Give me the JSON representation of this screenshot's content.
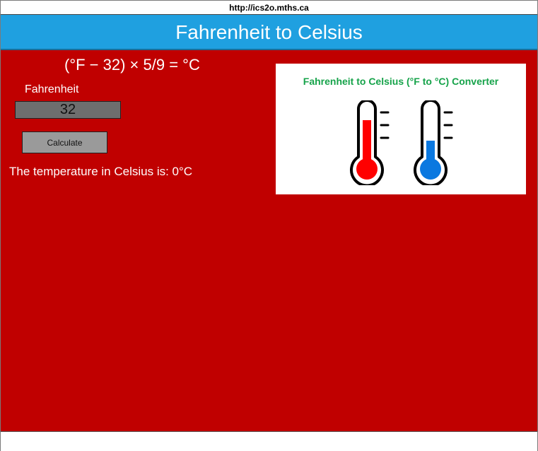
{
  "browser": {
    "url": "http://ics2o.mths.ca"
  },
  "header": {
    "title": "Fahrenheit to Celsius"
  },
  "main": {
    "formula": "(°F − 32) × 5/9 = °C",
    "input_label": "Fahrenheit",
    "input_value": "32",
    "button_label": "Calculate",
    "result_text": "The temperature in Celsius is: 0°C"
  },
  "image": {
    "title": "Fahrenheit to Celsius (°F to °C) Converter",
    "hot_icon": "thermometer-hot-icon",
    "cold_icon": "thermometer-cold-icon"
  },
  "colors": {
    "header_bg": "#1fa0e0",
    "page_bg": "#c00000",
    "hot": "#ff0000",
    "cold": "#0a78e0",
    "image_title": "#16a34a"
  }
}
